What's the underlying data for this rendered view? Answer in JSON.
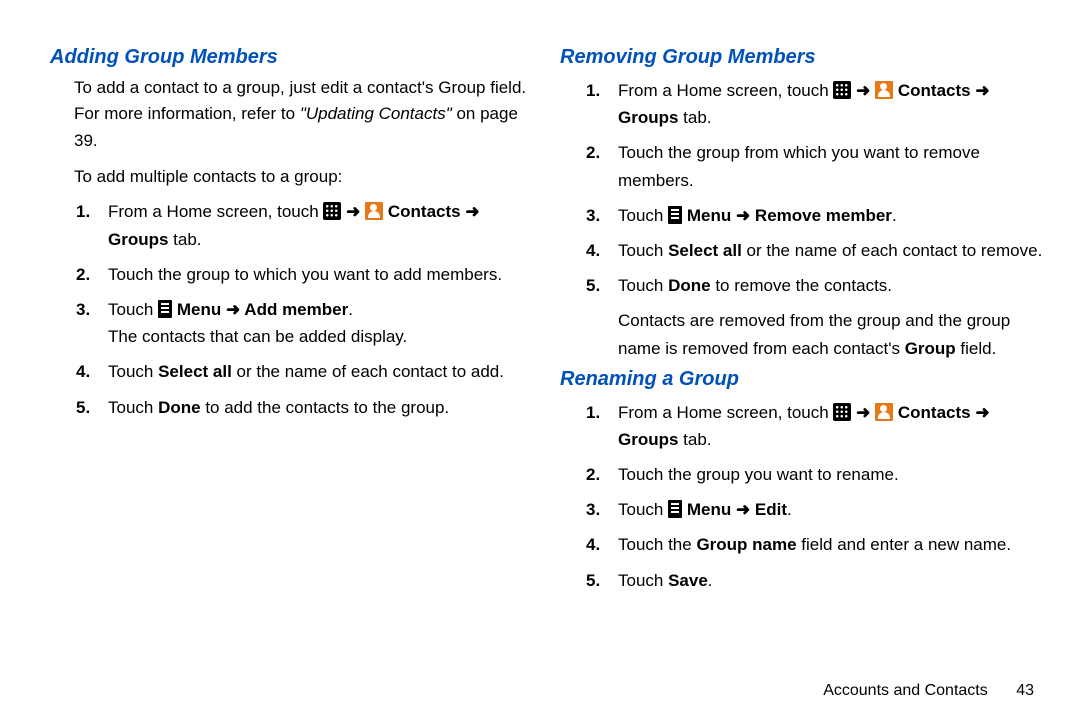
{
  "left": {
    "adding_title": "Adding Group Members",
    "intro_pre": "To add a contact to a group, just edit a contact's Group field. For more information, refer to ",
    "intro_ref": "\"Updating Contacts\"",
    "intro_post": " on page 39.",
    "lead": "To add multiple contacts to a group:",
    "s1_pre": "From a Home screen, touch ",
    "arrow": " ➜ ",
    "contacts_b": "Contacts",
    "groups_b": "Groups",
    "tab_word": " tab.",
    "s2": "Touch the group to which you want to add members.",
    "s3_pre": "Touch ",
    "menu_b": "Menu",
    "add_member_b": "Add member",
    "period": ".",
    "s3_post": "The contacts that can be added display.",
    "s4_pre": "Touch ",
    "select_all_b": "Select all",
    "s4_post": " or the name of each contact to add.",
    "s5_pre": "Touch ",
    "done_b": "Done",
    "s5_post": " to add the contacts to the group."
  },
  "right": {
    "removing_title": "Removing Group Members",
    "s1_pre": "From a Home screen, touch ",
    "arrow": " ➜ ",
    "contacts_b": "Contacts",
    "groups_b": "Groups",
    "tab_word": " tab.",
    "s2": "Touch the group from which you want to remove members.",
    "s3_pre": "Touch ",
    "menu_b": "Menu",
    "remove_member_b": "Remove member",
    "period": ".",
    "s4_pre": "Touch ",
    "select_all_b": "Select all",
    "s4_post": " or the name of each contact to remove.",
    "s5_pre": "Touch ",
    "done_b": "Done",
    "s5_post": " to remove the contacts.",
    "post_para_a": "Contacts are removed from the group and the group name is removed from each contact's ",
    "group_b": "Group",
    "post_para_b": " field.",
    "renaming_title": "Renaming a Group",
    "rs2": "Touch the group you want to rename.",
    "edit_b": "Edit",
    "rs4_pre": "Touch the ",
    "group_name_b": "Group name",
    "rs4_post": " field and enter a new name.",
    "rs5_pre": "Touch ",
    "save_b": "Save"
  },
  "footer": {
    "section": "Accounts and Contacts",
    "page": "43"
  }
}
